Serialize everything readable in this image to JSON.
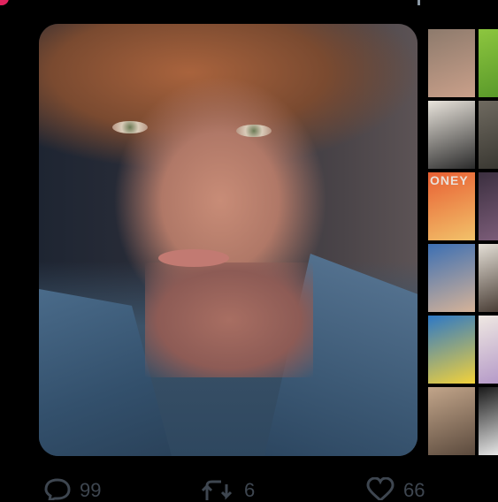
{
  "tweet": {
    "media": {
      "alt": "",
      "thumbnails": [
        {
          "label": "",
          "color_a": "#8d7a6c",
          "color_b": "#caa08a"
        },
        {
          "label": "",
          "color_a": "#8dc63f",
          "color_b": "#5a9a2a"
        },
        {
          "label": "",
          "color_a": "#e9e4dc",
          "color_b": "#2b2b2b"
        },
        {
          "label": "",
          "color_a": "#6f6a60",
          "color_b": "#3a3832"
        },
        {
          "label": "ONEY",
          "color_a": "#e85f33",
          "color_b": "#f2c26a"
        },
        {
          "label": "",
          "color_a": "#3b2f3f",
          "color_b": "#7b5c78"
        },
        {
          "label": "",
          "color_a": "#3c6fb3",
          "color_b": "#d6b398"
        },
        {
          "label": "",
          "color_a": "#e4dfd6",
          "color_b": "#4a3e36"
        },
        {
          "label": "",
          "color_a": "#2d78c6",
          "color_b": "#f3d23a"
        },
        {
          "label": "",
          "color_a": "#efe8e2",
          "color_b": "#b59ac8"
        },
        {
          "label": "",
          "color_a": "#c2a58a",
          "color_b": "#5b4a3d"
        },
        {
          "label": "",
          "color_a": "#1a1a1a",
          "color_b": "#e6e6e6"
        }
      ]
    },
    "actions": {
      "reply_count": "99",
      "retweet_count": "6",
      "like_count": "66"
    }
  },
  "colors": {
    "background": "#000000",
    "action_icon": "#3e4650"
  }
}
